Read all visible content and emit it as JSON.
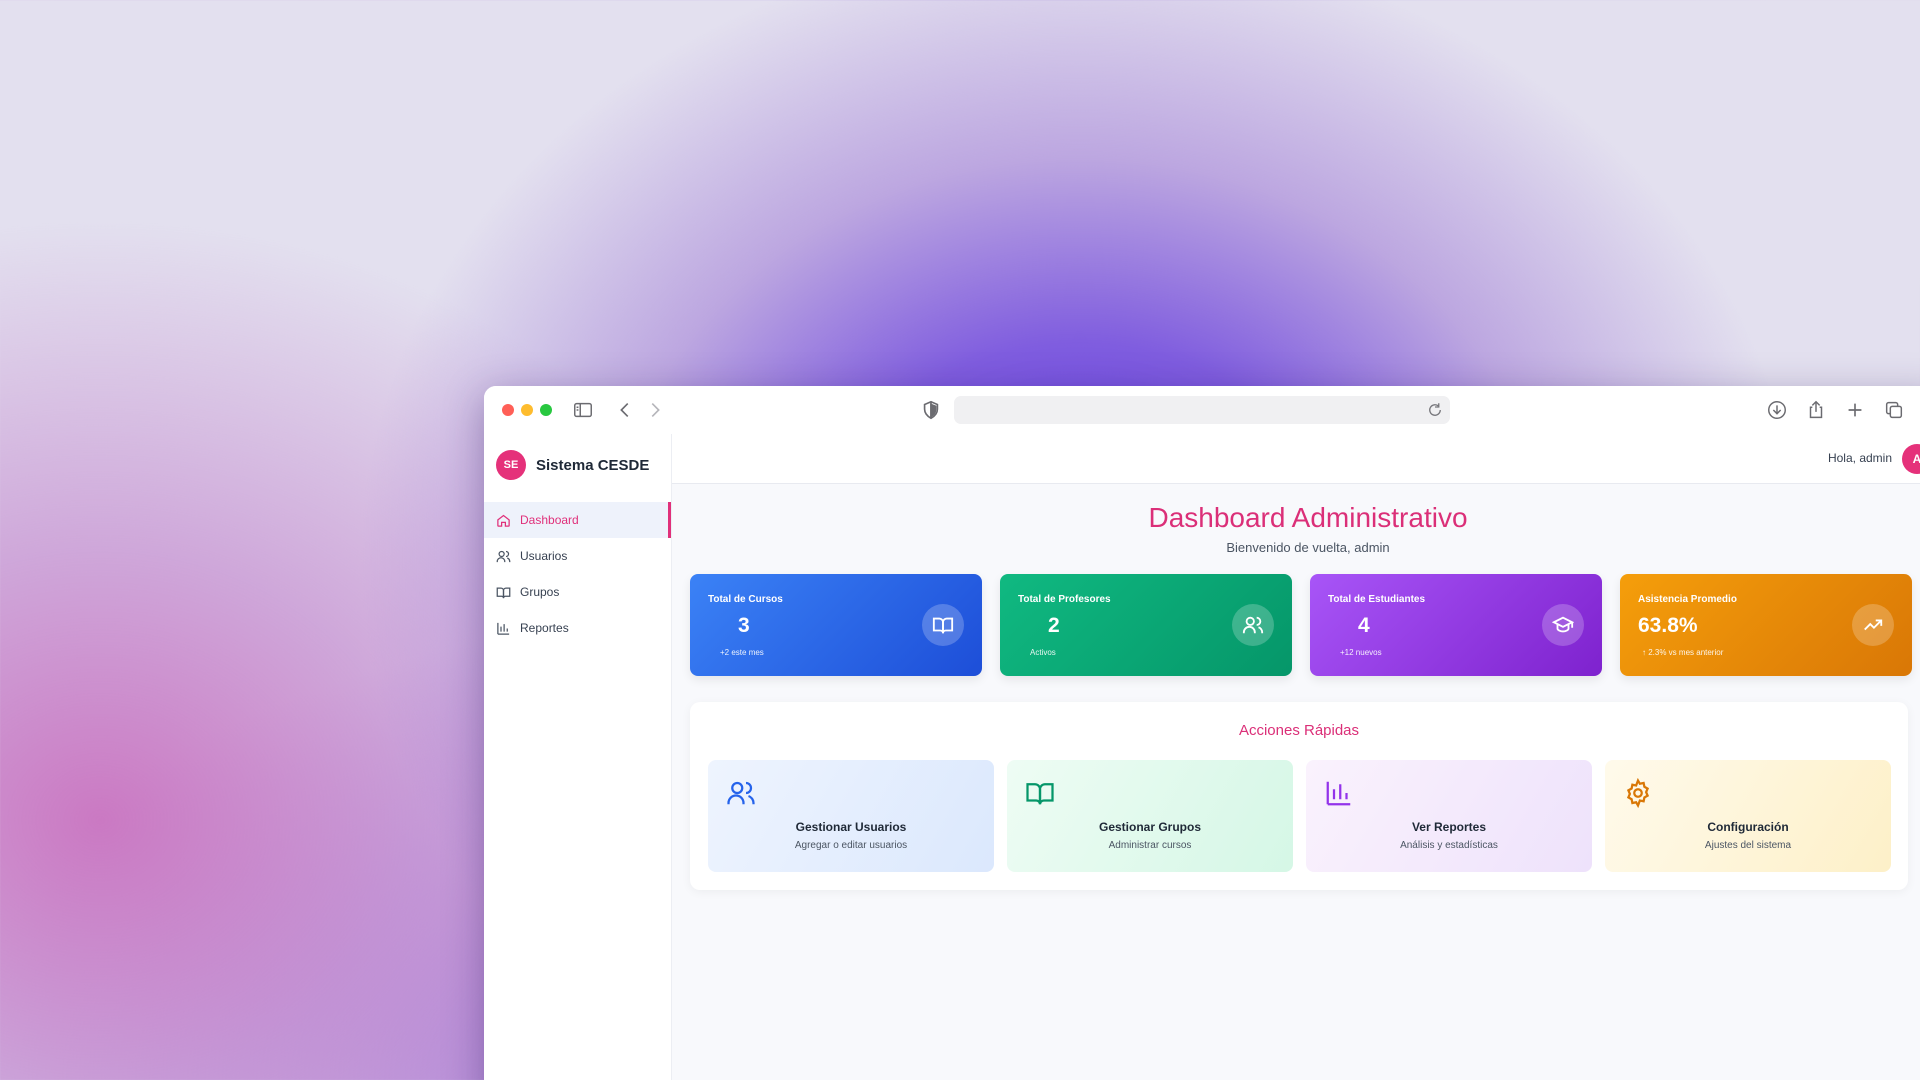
{
  "browser": {
    "address": ""
  },
  "sidebar": {
    "brand_logo": "SE",
    "brand_name": "Sistema CESDE",
    "items": [
      {
        "label": "Dashboard",
        "icon": "home-icon"
      },
      {
        "label": "Usuarios",
        "icon": "users-icon"
      },
      {
        "label": "Grupos",
        "icon": "book-icon"
      },
      {
        "label": "Reportes",
        "icon": "bar-chart-icon"
      }
    ]
  },
  "header": {
    "greeting": "Hola, admin",
    "avatar": "A"
  },
  "main": {
    "title": "Dashboard Administrativo",
    "subtitle": "Bienvenido de vuelta, admin",
    "stats": [
      {
        "label": "Total de Cursos",
        "value": "3",
        "note": "+2 este mes",
        "icon": "book-icon"
      },
      {
        "label": "Total de Profesores",
        "value": "2",
        "note": "Activos",
        "icon": "users-icon"
      },
      {
        "label": "Total de Estudiantes",
        "value": "4",
        "note": "+12 nuevos",
        "icon": "graduation-cap-icon"
      },
      {
        "label": "Asistencia Promedio",
        "value": "63.8%",
        "note": "↑ 2.3% vs mes anterior",
        "icon": "trending-up-icon"
      }
    ],
    "quick_actions": {
      "title": "Acciones Rápidas",
      "items": [
        {
          "title": "Gestionar Usuarios",
          "desc": "Agregar o editar usuarios",
          "icon": "users-icon",
          "color": "#2563eb"
        },
        {
          "title": "Gestionar Grupos",
          "desc": "Administrar cursos",
          "icon": "book-icon",
          "color": "#059669"
        },
        {
          "title": "Ver Reportes",
          "desc": "Análisis y estadísticas",
          "icon": "bar-chart-icon",
          "color": "#9333ea"
        },
        {
          "title": "Configuración",
          "desc": "Ajustes del sistema",
          "icon": "gear-icon",
          "color": "#d97706"
        }
      ]
    }
  },
  "colors": {
    "accent": "#db2f78",
    "blue": "#1d4ed8",
    "green": "#059669",
    "purple": "#7e22ce",
    "orange": "#d97706"
  }
}
